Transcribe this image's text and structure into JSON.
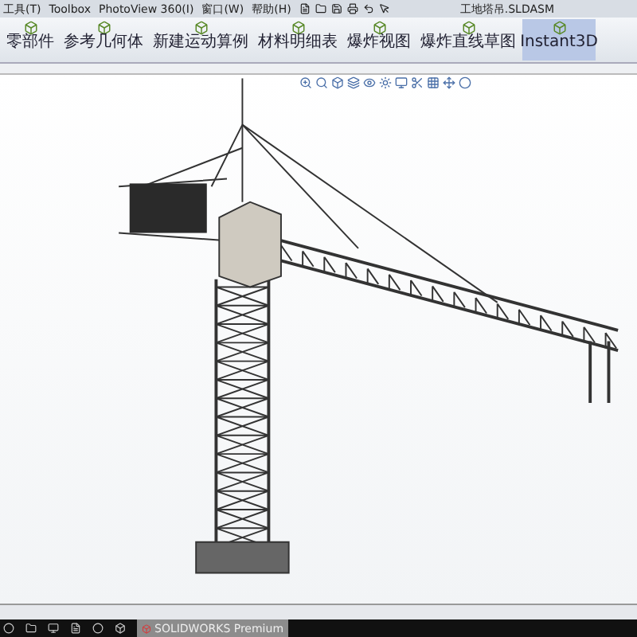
{
  "menu_bar": {
    "items": [
      "工具(T)",
      "Toolbox",
      "PhotoView 360(I)",
      "窗口(W)",
      "帮助(H)"
    ],
    "title": "工地塔吊.SLDASM"
  },
  "ribbon": {
    "buttons": [
      {
        "label": "零部件",
        "selected": false
      },
      {
        "label": "参考几何体",
        "selected": false
      },
      {
        "label": "新建运动算例",
        "selected": false
      },
      {
        "label": "材料明细表",
        "selected": false
      },
      {
        "label": "爆炸视图",
        "selected": false
      },
      {
        "label": "爆炸直线草图",
        "selected": false
      },
      {
        "label": "Instant3D",
        "selected": true
      }
    ]
  },
  "taskbar": {
    "active_task": "SOLIDWORKS Premium"
  }
}
